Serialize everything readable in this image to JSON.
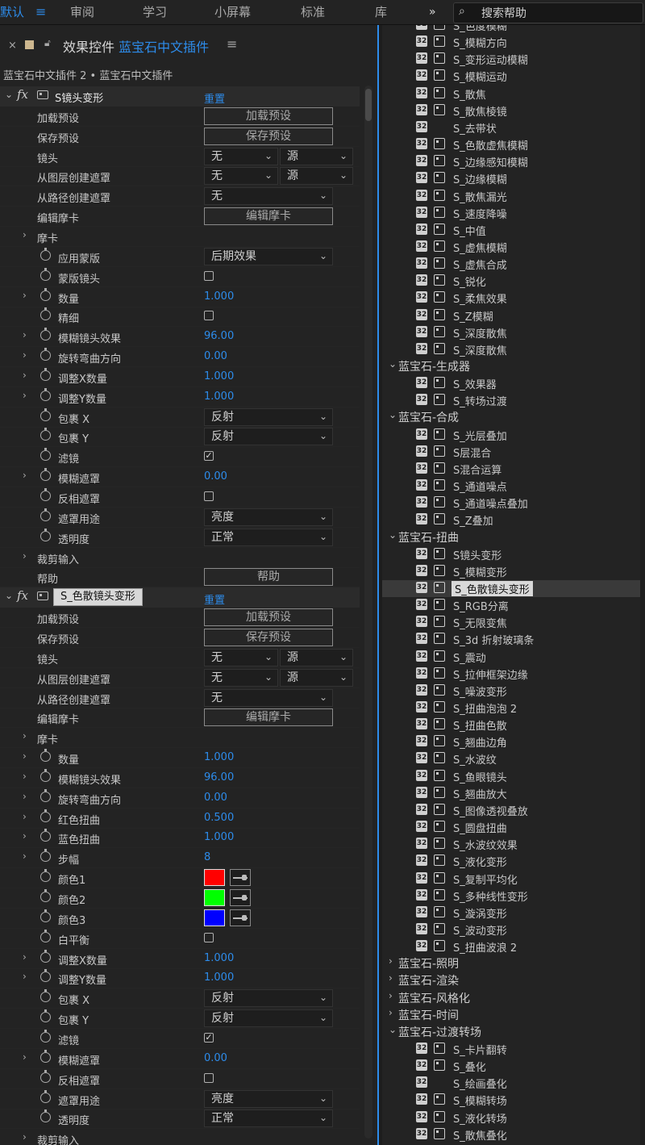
{
  "topbar": {
    "workspaces": [
      "默认",
      "审阅",
      "学习",
      "小屏幕",
      "标准",
      "库"
    ],
    "active": "默认",
    "more": "»",
    "search_placeholder": "搜索帮助"
  },
  "effect_controls": {
    "close": "×",
    "title": "效果控件",
    "plugin": "蓝宝石中文插件",
    "menu": "≡",
    "breadcrumb": "蓝宝石中文插件 2 • 蓝宝石中文插件",
    "fx1": {
      "name": "S镜头变形",
      "reset": "重置",
      "rows": [
        {
          "label": "加载预设",
          "type": "button",
          "value": "加载预设"
        },
        {
          "label": "保存预设",
          "type": "button",
          "value": "保存预设"
        },
        {
          "label": "镜头",
          "type": "dd2",
          "value": "无",
          "value2": "源"
        },
        {
          "label": "从图层创建遮罩",
          "type": "dd2",
          "value": "无",
          "value2": "源"
        },
        {
          "label": "从路径创建遮罩",
          "type": "dd",
          "value": "无"
        },
        {
          "label": "编辑摩卡",
          "type": "button",
          "value": "编辑摩卡"
        },
        {
          "label": "摩卡",
          "type": "group"
        },
        {
          "label": "应用蒙版",
          "type": "dd",
          "value": "后期效果",
          "stopwatch": true
        },
        {
          "label": "蒙版镜头",
          "type": "cb",
          "checked": false,
          "stopwatch": true
        },
        {
          "label": "数量",
          "type": "num",
          "value": "1.000",
          "stopwatch": true,
          "twirl": true
        },
        {
          "label": "精细",
          "type": "cb",
          "checked": false,
          "stopwatch": true
        },
        {
          "label": "模糊镜头效果",
          "type": "num",
          "value": "96.00",
          "stopwatch": true,
          "twirl": true
        },
        {
          "label": "旋转弯曲方向",
          "type": "num",
          "value": "0.00",
          "stopwatch": true,
          "twirl": true
        },
        {
          "label": "调整X数量",
          "type": "num",
          "value": "1.000",
          "stopwatch": true,
          "twirl": true
        },
        {
          "label": "调整Y数量",
          "type": "num",
          "value": "1.000",
          "stopwatch": true,
          "twirl": true
        },
        {
          "label": "包裹 X",
          "type": "dd",
          "value": "反射",
          "stopwatch": true
        },
        {
          "label": "包裹 Y",
          "type": "dd",
          "value": "反射",
          "stopwatch": true
        },
        {
          "label": "滤镜",
          "type": "cb",
          "checked": true,
          "stopwatch": true
        },
        {
          "label": "模糊遮罩",
          "type": "num",
          "value": "0.00",
          "stopwatch": true,
          "twirl": true
        },
        {
          "label": "反相遮罩",
          "type": "cb",
          "checked": false,
          "stopwatch": true
        },
        {
          "label": "遮罩用途",
          "type": "dd",
          "value": "亮度",
          "stopwatch": true
        },
        {
          "label": "透明度",
          "type": "dd",
          "value": "正常",
          "stopwatch": true
        },
        {
          "label": "裁剪输入",
          "type": "group"
        },
        {
          "label": "帮助",
          "type": "button",
          "value": "帮助"
        }
      ]
    },
    "fx2": {
      "name": "S_色散镜头变形",
      "reset": "重置",
      "rows": [
        {
          "label": "加载预设",
          "type": "button",
          "value": "加载预设"
        },
        {
          "label": "保存预设",
          "type": "button",
          "value": "保存预设"
        },
        {
          "label": "镜头",
          "type": "dd2",
          "value": "无",
          "value2": "源"
        },
        {
          "label": "从图层创建遮罩",
          "type": "dd2",
          "value": "无",
          "value2": "源"
        },
        {
          "label": "从路径创建遮罩",
          "type": "dd",
          "value": "无"
        },
        {
          "label": "编辑摩卡",
          "type": "button",
          "value": "编辑摩卡"
        },
        {
          "label": "摩卡",
          "type": "group"
        },
        {
          "label": "数量",
          "type": "num",
          "value": "1.000",
          "stopwatch": true,
          "twirl": true
        },
        {
          "label": "模糊镜头效果",
          "type": "num",
          "value": "96.00",
          "stopwatch": true,
          "twirl": true
        },
        {
          "label": "旋转弯曲方向",
          "type": "num",
          "value": "0.00",
          "stopwatch": true,
          "twirl": true
        },
        {
          "label": "红色扭曲",
          "type": "num",
          "value": "0.500",
          "stopwatch": true,
          "twirl": true
        },
        {
          "label": "蓝色扭曲",
          "type": "num",
          "value": "1.000",
          "stopwatch": true,
          "twirl": true
        },
        {
          "label": "步幅",
          "type": "num",
          "value": "8",
          "stopwatch": true,
          "twirl": true
        },
        {
          "label": "颜色1",
          "type": "color",
          "value": "#ff0000",
          "stopwatch": true
        },
        {
          "label": "颜色2",
          "type": "color",
          "value": "#00ff00",
          "stopwatch": true
        },
        {
          "label": "颜色3",
          "type": "color",
          "value": "#0000ff",
          "stopwatch": true
        },
        {
          "label": "白平衡",
          "type": "cb",
          "checked": false,
          "stopwatch": true
        },
        {
          "label": "调整X数量",
          "type": "num",
          "value": "1.000",
          "stopwatch": true,
          "twirl": true
        },
        {
          "label": "调整Y数量",
          "type": "num",
          "value": "1.000",
          "stopwatch": true,
          "twirl": true
        },
        {
          "label": "包裹 X",
          "type": "dd",
          "value": "反射",
          "stopwatch": true
        },
        {
          "label": "包裹 Y",
          "type": "dd",
          "value": "反射",
          "stopwatch": true
        },
        {
          "label": "滤镜",
          "type": "cb",
          "checked": true,
          "stopwatch": true
        },
        {
          "label": "模糊遮罩",
          "type": "num",
          "value": "0.00",
          "stopwatch": true,
          "twirl": true
        },
        {
          "label": "反相遮罩",
          "type": "cb",
          "checked": false,
          "stopwatch": true
        },
        {
          "label": "遮罩用途",
          "type": "dd",
          "value": "亮度",
          "stopwatch": true
        },
        {
          "label": "透明度",
          "type": "dd",
          "value": "正常",
          "stopwatch": true
        },
        {
          "label": "裁剪输入",
          "type": "group"
        }
      ]
    }
  },
  "effects_panel": {
    "items": [
      {
        "kind": "item",
        "text": "S_色度模糊"
      },
      {
        "kind": "item",
        "text": "S_模糊方向"
      },
      {
        "kind": "item",
        "text": "S_变形运动模糊"
      },
      {
        "kind": "item",
        "text": "S_模糊运动"
      },
      {
        "kind": "item",
        "text": "S_散焦"
      },
      {
        "kind": "item",
        "text": "S_散焦棱镜"
      },
      {
        "kind": "item",
        "text": "S_去带状",
        "noicon2": true
      },
      {
        "kind": "item",
        "text": "S_色散虚焦模糊"
      },
      {
        "kind": "item",
        "text": "S_边缘感知模糊"
      },
      {
        "kind": "item",
        "text": "S_边缘模糊"
      },
      {
        "kind": "item",
        "text": "S_散焦漏光"
      },
      {
        "kind": "item",
        "text": "S_速度降噪"
      },
      {
        "kind": "item",
        "text": "S_中值"
      },
      {
        "kind": "item",
        "text": "S_虚焦模糊"
      },
      {
        "kind": "item",
        "text": "S_虚焦合成"
      },
      {
        "kind": "item",
        "text": "S_锐化"
      },
      {
        "kind": "item",
        "text": "S_柔焦效果"
      },
      {
        "kind": "item",
        "text": "S_Z模糊"
      },
      {
        "kind": "item",
        "text": "S_深度散焦"
      },
      {
        "kind": "item",
        "text": "S_深度散焦"
      },
      {
        "kind": "cat",
        "text": "蓝宝石-生成器",
        "open": true
      },
      {
        "kind": "item",
        "text": "S_效果器"
      },
      {
        "kind": "item",
        "text": "S_转场过渡"
      },
      {
        "kind": "cat",
        "text": "蓝宝石-合成",
        "open": true
      },
      {
        "kind": "item",
        "text": "S_光层叠加"
      },
      {
        "kind": "item",
        "text": "S层混合"
      },
      {
        "kind": "item",
        "text": "S混合运算"
      },
      {
        "kind": "item",
        "text": "S_通道噪点"
      },
      {
        "kind": "item",
        "text": "S_通道噪点叠加"
      },
      {
        "kind": "item",
        "text": "S_Z叠加"
      },
      {
        "kind": "cat",
        "text": "蓝宝石-扭曲",
        "open": true
      },
      {
        "kind": "item",
        "text": "S镜头变形"
      },
      {
        "kind": "item",
        "text": "S_模糊变形"
      },
      {
        "kind": "item",
        "text": "S_色散镜头变形",
        "selected": true
      },
      {
        "kind": "item",
        "text": "S_RGB分离"
      },
      {
        "kind": "item",
        "text": "S_无限变焦"
      },
      {
        "kind": "item",
        "text": "S_3d 折射玻璃条"
      },
      {
        "kind": "item",
        "text": "S_震动"
      },
      {
        "kind": "item",
        "text": "S_拉伸框架边缘"
      },
      {
        "kind": "item",
        "text": "S_噪波变形"
      },
      {
        "kind": "item",
        "text": "S_扭曲泡泡 2"
      },
      {
        "kind": "item",
        "text": "S_扭曲色散"
      },
      {
        "kind": "item",
        "text": "S_翘曲边角"
      },
      {
        "kind": "item",
        "text": "S_水波纹"
      },
      {
        "kind": "item",
        "text": "S_鱼眼镜头"
      },
      {
        "kind": "item",
        "text": "S_翘曲放大"
      },
      {
        "kind": "item",
        "text": "S_图像透视叠放"
      },
      {
        "kind": "item",
        "text": "S_圆盘扭曲"
      },
      {
        "kind": "item",
        "text": "S_水波纹效果"
      },
      {
        "kind": "item",
        "text": "S_液化变形"
      },
      {
        "kind": "item",
        "text": "S_复制平均化"
      },
      {
        "kind": "item",
        "text": "S_多种线性变形"
      },
      {
        "kind": "item",
        "text": "S_漩涡变形"
      },
      {
        "kind": "item",
        "text": "S_波动变形"
      },
      {
        "kind": "item",
        "text": "S_扭曲波浪 2"
      },
      {
        "kind": "cat",
        "text": "蓝宝石-照明",
        "open": false
      },
      {
        "kind": "cat",
        "text": "蓝宝石-渲染",
        "open": false
      },
      {
        "kind": "cat",
        "text": "蓝宝石-风格化",
        "open": false
      },
      {
        "kind": "cat",
        "text": "蓝宝石-时间",
        "open": false
      },
      {
        "kind": "cat",
        "text": "蓝宝石-过渡转场",
        "open": true
      },
      {
        "kind": "item",
        "text": "S_卡片翻转"
      },
      {
        "kind": "item",
        "text": "S_叠化"
      },
      {
        "kind": "item",
        "text": "S_绘画叠化",
        "noicon2": true
      },
      {
        "kind": "item",
        "text": "S_模糊转场"
      },
      {
        "kind": "item",
        "text": "S_液化转场"
      },
      {
        "kind": "item",
        "text": "S_散焦叠化"
      }
    ],
    "badge": "32"
  }
}
